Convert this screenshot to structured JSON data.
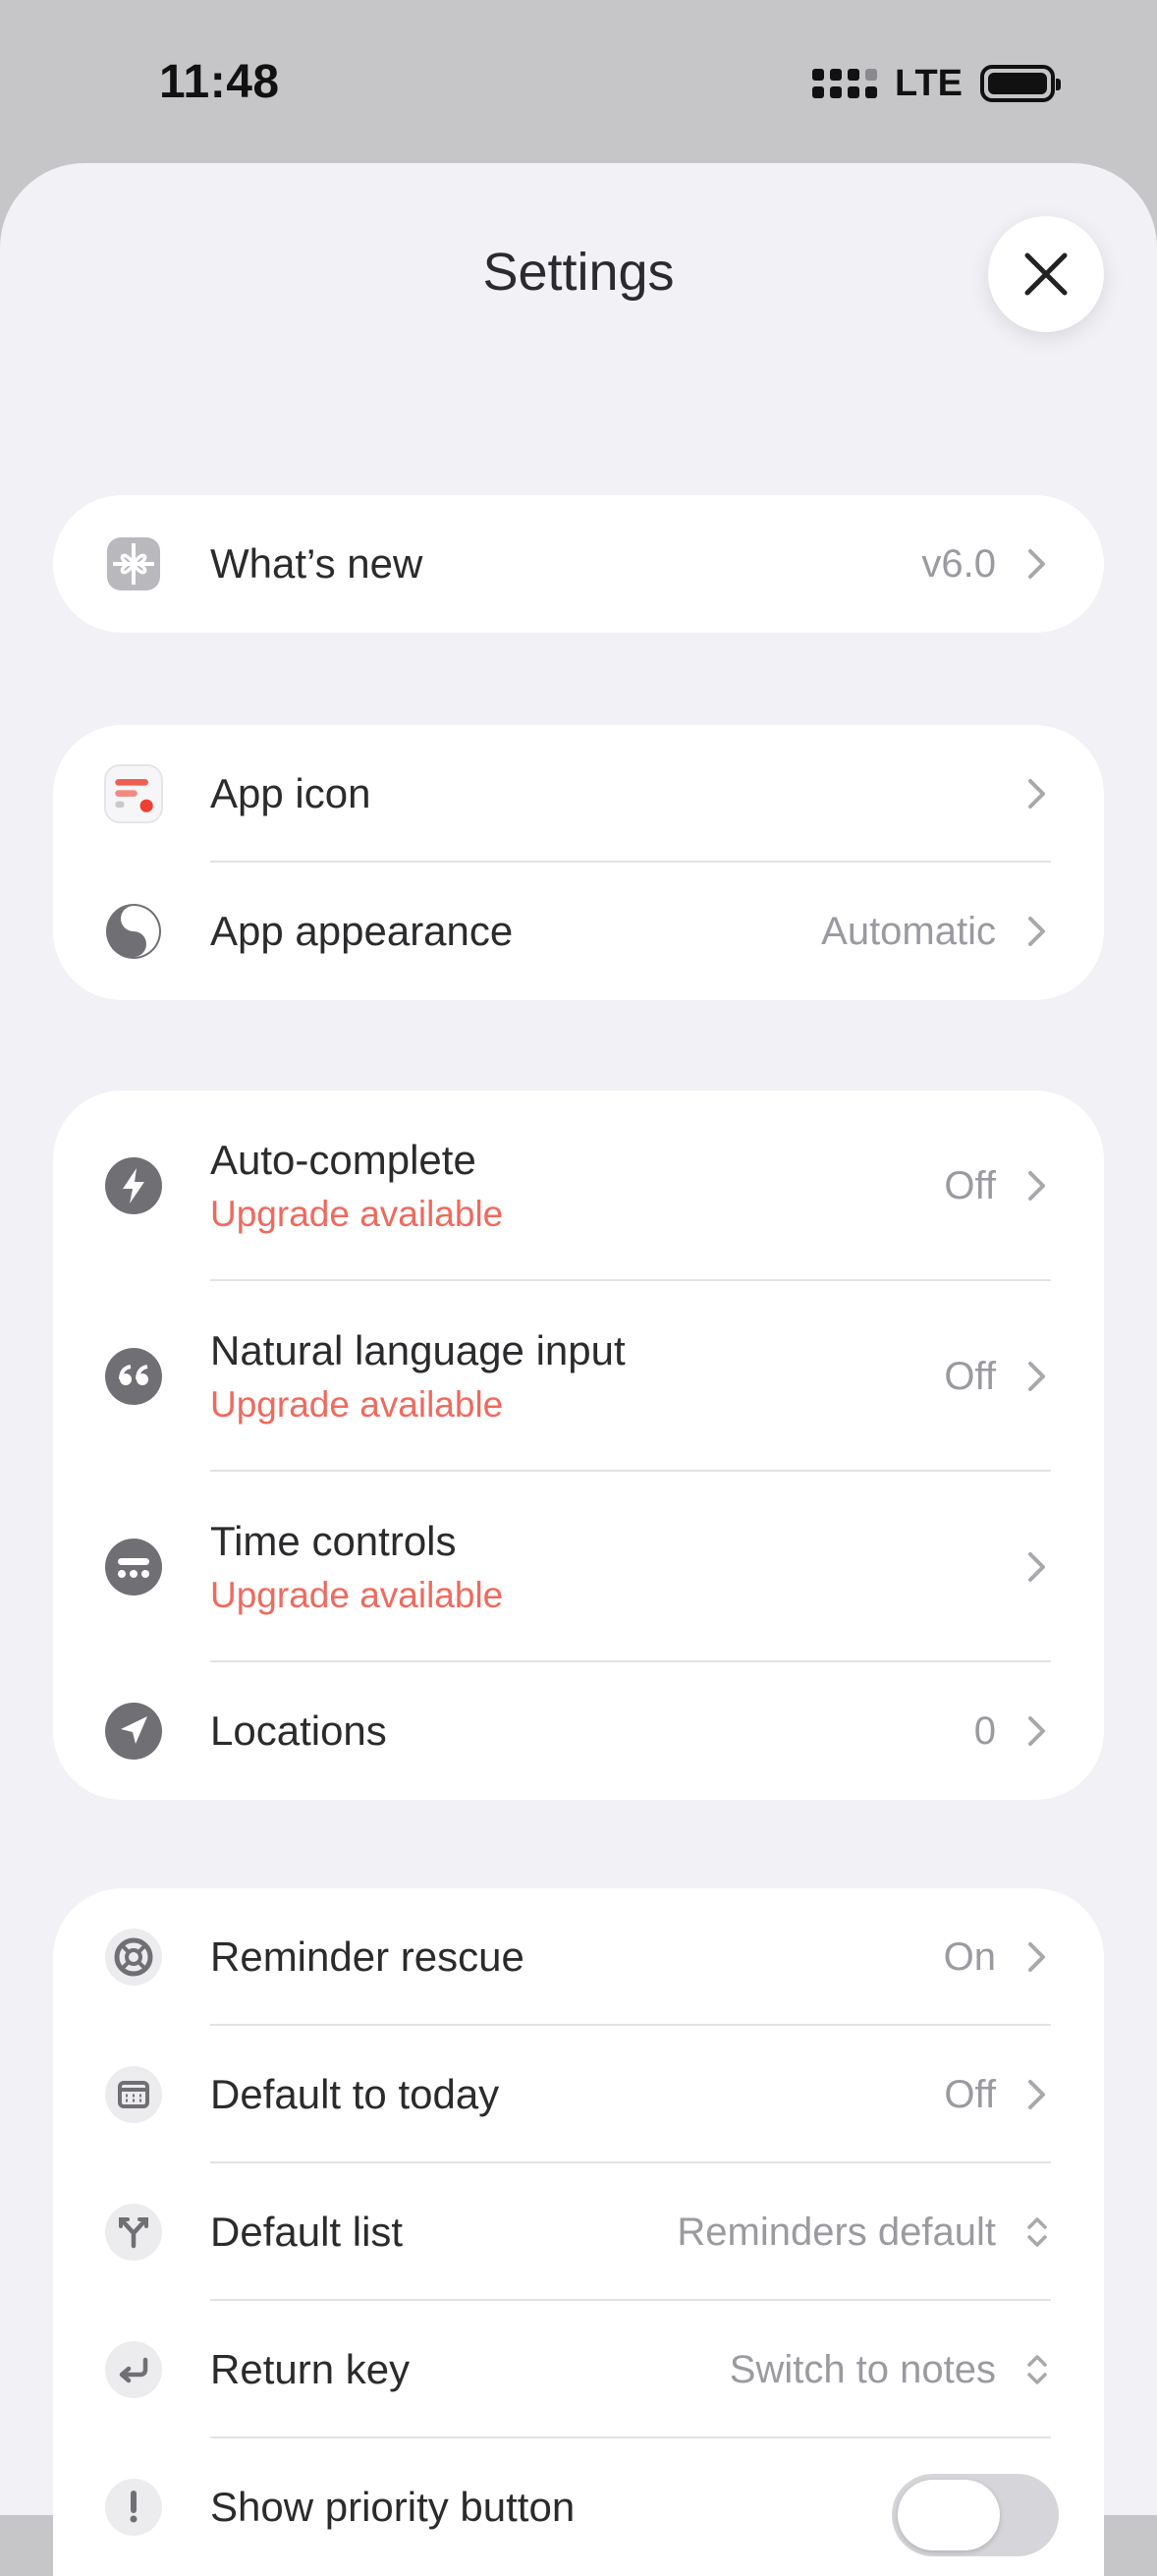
{
  "status_bar": {
    "time": "11:48",
    "network": "LTE"
  },
  "header": {
    "title": "Settings"
  },
  "groups": {
    "whats_new": {
      "label": "What’s new",
      "value": "v6.0"
    },
    "app_icon": {
      "label": "App icon"
    },
    "app_appearance": {
      "label": "App appearance",
      "value": "Automatic"
    },
    "auto_complete": {
      "label": "Auto-complete",
      "sublabel": "Upgrade available",
      "value": "Off"
    },
    "natural_language": {
      "label": "Natural language input",
      "sublabel": "Upgrade available",
      "value": "Off"
    },
    "time_controls": {
      "label": "Time controls",
      "sublabel": "Upgrade available"
    },
    "locations": {
      "label": "Locations",
      "value": "0"
    },
    "reminder_rescue": {
      "label": "Reminder rescue",
      "value": "On"
    },
    "default_today": {
      "label": "Default to today",
      "value": "Off"
    },
    "default_list": {
      "label": "Default list",
      "value": "Reminders default"
    },
    "return_key": {
      "label": "Return key",
      "value": "Switch to notes"
    },
    "show_priority": {
      "label": "Show priority button",
      "enabled": false
    }
  },
  "colors": {
    "accent_upgrade": "#ef6a5e",
    "background": "#f1f1f6",
    "card": "#ffffff",
    "secondary_text": "#9a9aa0",
    "icon_gray": "#6f6f74"
  },
  "icons": {
    "whats_new": "gift-icon",
    "app_icon": "app-logo-icon",
    "app_appearance": "half-moon-icon",
    "auto_complete": "bolt-icon",
    "natural_language": "quote-icon",
    "time_controls": "time-controls-icon",
    "locations": "location-arrow-icon",
    "reminder_rescue": "lifebuoy-icon",
    "default_today": "calendar-icon",
    "default_list": "fork-icon",
    "return_key": "return-arrow-icon",
    "show_priority": "exclamation-icon"
  }
}
